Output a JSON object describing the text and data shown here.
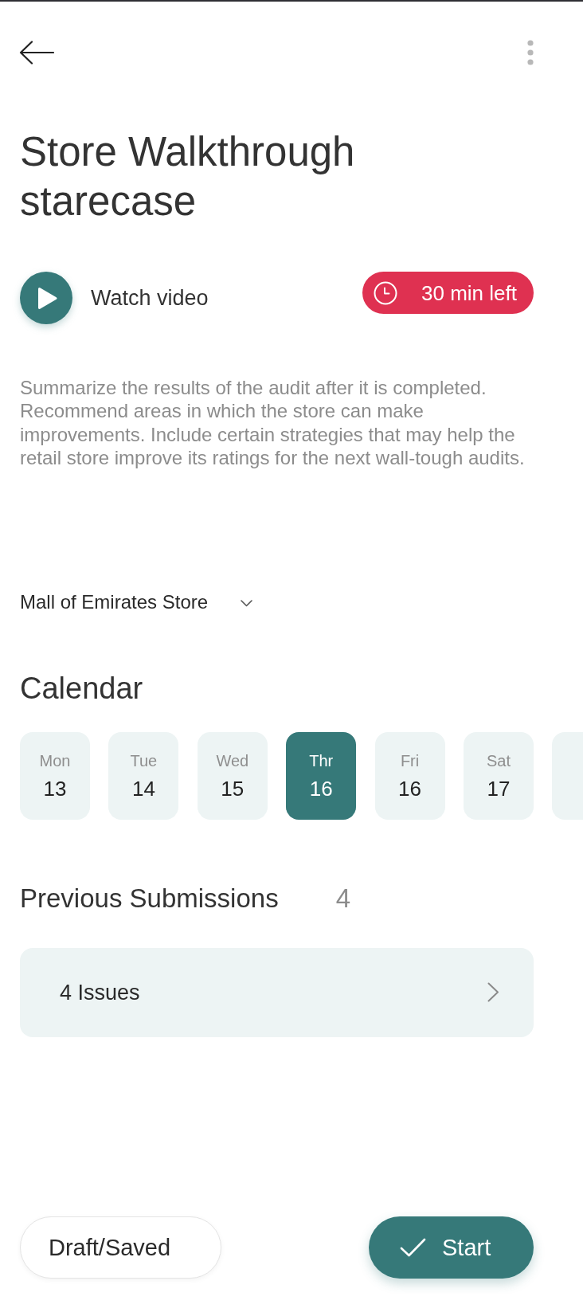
{
  "title": "Store Walkthrough starecase",
  "video": {
    "label": "Watch video"
  },
  "timer": {
    "label": "30 min left"
  },
  "description": "Summarize the results of the audit after it is completed. Recommend areas in which the store can make improvements. Include certain strategies that may help the retail store improve its ratings for the next wall-tough audits.",
  "store_select": {
    "value": "Mall of Emirates Store"
  },
  "calendar": {
    "title": "Calendar",
    "days": [
      {
        "day": "Mon",
        "date": "13",
        "selected": false
      },
      {
        "day": "Tue",
        "date": "14",
        "selected": false
      },
      {
        "day": "Wed",
        "date": "15",
        "selected": false
      },
      {
        "day": "Thr",
        "date": "16",
        "selected": true
      },
      {
        "day": "Fri",
        "date": "16",
        "selected": false
      },
      {
        "day": "Sat",
        "date": "17",
        "selected": false
      },
      {
        "selected": false
      }
    ]
  },
  "previous_submissions": {
    "title": "Previous Submissions",
    "count": "4",
    "items": [
      {
        "label": "4 Issues"
      }
    ]
  },
  "actions": [
    {
      "kind": "secondary",
      "label": "Draft/Saved"
    },
    {
      "kind": "primary",
      "label": "Start"
    }
  ]
}
